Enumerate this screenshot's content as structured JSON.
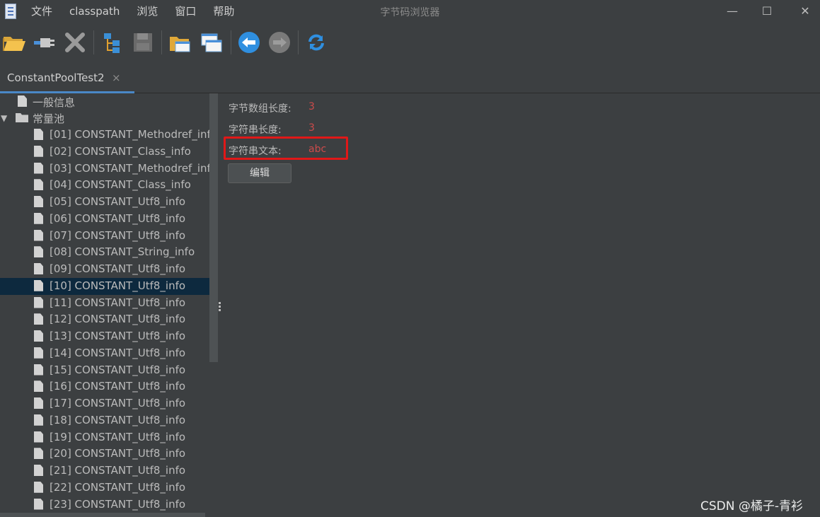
{
  "window": {
    "title": "字节码浏览器",
    "menu": [
      "文件",
      "classpath",
      "浏览",
      "窗口",
      "帮助"
    ],
    "controls": [
      "—",
      "☐",
      "✕"
    ]
  },
  "toolbar": {
    "icons": [
      "open-folder-icon",
      "connect-plug-icon",
      "close-x-icon",
      "tree-structure-icon",
      "save-disk-icon",
      "open-folder-multi-icon",
      "window-icon",
      "back-arrow-icon",
      "forward-arrow-icon",
      "refresh-icon"
    ]
  },
  "tab": {
    "label": "ConstantPoolTest2",
    "close": "×"
  },
  "tree": {
    "general": "一般信息",
    "pool": "常量池",
    "items": [
      "[01] CONSTANT_Methodref_inf",
      "[02] CONSTANT_Class_info",
      "[03] CONSTANT_Methodref_inf",
      "[04] CONSTANT_Class_info",
      "[05] CONSTANT_Utf8_info",
      "[06] CONSTANT_Utf8_info",
      "[07] CONSTANT_Utf8_info",
      "[08] CONSTANT_String_info",
      "[09] CONSTANT_Utf8_info",
      "[10] CONSTANT_Utf8_info",
      "[11] CONSTANT_Utf8_info",
      "[12] CONSTANT_Utf8_info",
      "[13] CONSTANT_Utf8_info",
      "[14] CONSTANT_Utf8_info",
      "[15] CONSTANT_Utf8_info",
      "[16] CONSTANT_Utf8_info",
      "[17] CONSTANT_Utf8_info",
      "[18] CONSTANT_Utf8_info",
      "[19] CONSTANT_Utf8_info",
      "[20] CONSTANT_Utf8_info",
      "[21] CONSTANT_Utf8_info",
      "[22] CONSTANT_Utf8_info",
      "[23] CONSTANT_Utf8_info"
    ],
    "selected": "[10] CONSTANT_Utf8_info"
  },
  "details": {
    "byte_length_label": "字节数组长度:",
    "byte_length_value": "3",
    "string_length_label": "字符串长度:",
    "string_length_value": "3",
    "string_text_label": "字符串文本:",
    "string_text_value": "abc",
    "edit_button": "编辑"
  },
  "watermark": "CSDN @橘子-青衫",
  "colors": {
    "background": "#3c3f41",
    "value_red": "#cc4b4b",
    "highlight_box": "#e01818",
    "selection": "#0d293e",
    "tab_underline": "#4a88c7"
  }
}
